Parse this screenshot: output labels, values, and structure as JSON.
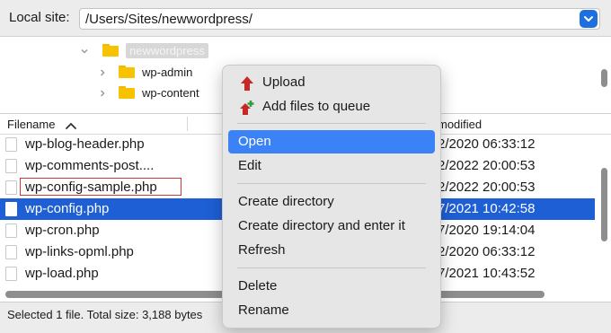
{
  "local_site": {
    "label": "Local site:",
    "path": "/Users/Sites/newwordpress/",
    "dropdown_icon": "chevron-down-icon"
  },
  "tree": {
    "items": [
      {
        "label": "newwordpress",
        "expanded": true,
        "selected": true
      },
      {
        "label": "wp-admin",
        "expanded": false,
        "selected": false
      },
      {
        "label": "wp-content",
        "expanded": false,
        "selected": false
      }
    ]
  },
  "file_list": {
    "columns": {
      "filename": "Filename",
      "modified": "modified"
    },
    "rows": [
      {
        "name": "wp-blog-header.php",
        "modified": "2/2020 06:33:12",
        "selected": false
      },
      {
        "name": "wp-comments-post....",
        "modified": "2/2022 20:00:53",
        "selected": false
      },
      {
        "name": "wp-config-sample.php",
        "modified": "2/2022 20:00:53",
        "selected": false
      },
      {
        "name": "wp-config.php",
        "modified": "7/2021 10:42:58",
        "selected": true
      },
      {
        "name": "wp-cron.php",
        "modified": "7/2020 19:14:04",
        "selected": false
      },
      {
        "name": "wp-links-opml.php",
        "modified": "2/2020 06:33:12",
        "selected": false
      },
      {
        "name": "wp-load.php",
        "modified": "7/2021 10:43:52",
        "selected": false
      }
    ]
  },
  "status": {
    "text": "Selected 1 file. Total size: 3,188 bytes"
  },
  "context_menu": {
    "items": [
      {
        "label": "Upload",
        "icon": "upload-arrow-icon"
      },
      {
        "label": "Add files to queue",
        "icon": "add-to-queue-icon"
      },
      {
        "label": "Open",
        "highlighted": true
      },
      {
        "label": "Edit"
      },
      {
        "label": "Create directory"
      },
      {
        "label": "Create directory and enter it"
      },
      {
        "label": "Refresh"
      },
      {
        "label": "Delete"
      },
      {
        "label": "Rename"
      }
    ]
  },
  "colors": {
    "selection": "#1e5fd6",
    "menu_highlight": "#3b82f6",
    "folder": "#f7c200",
    "upload_arrow": "#c62828",
    "queue_plus": "#2e9e3a"
  }
}
